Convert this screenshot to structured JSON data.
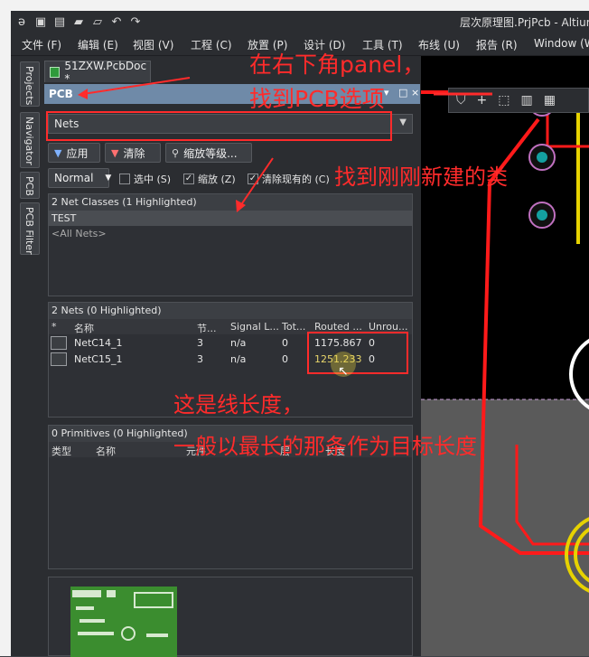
{
  "window": {
    "title": "层次原理图.PrjPcb - Altium"
  },
  "quick_access": [
    "folder-icon",
    "save-icon",
    "save-all-icon",
    "open-icon",
    "open-icon",
    "undo-icon",
    "redo-icon"
  ],
  "menu": [
    "文件 (F)",
    "编辑 (E)",
    "视图 (V)",
    "工程 (C)",
    "放置 (P)",
    "设计 (D)",
    "工具 (T)",
    "布线 (U)",
    "报告 (R)",
    "Window (W"
  ],
  "side_tabs": [
    "Projects",
    "Navigator",
    "PCB",
    "PCB Filter"
  ],
  "doc_tab": "51ZXW.PcbDoc *",
  "panel": {
    "title": "PCB",
    "header_buttons": [
      "▾",
      "□",
      "×"
    ],
    "mode_dropdown": "Nets",
    "buttons": {
      "apply": "应用",
      "clear": "清除",
      "zoom": "缩放等级..."
    },
    "view_mode": "Normal",
    "checkboxes": [
      {
        "label": "选中 (S)",
        "checked": false
      },
      {
        "label": "缩放 (Z)",
        "checked": true
      },
      {
        "label": "清除现有的 (C)",
        "checked": true
      }
    ],
    "net_classes": {
      "header": "2 Net Classes (1 Highlighted)",
      "items": [
        "TEST",
        "<All Nets>"
      ]
    },
    "nets": {
      "header": "2 Nets (0 Highlighted)",
      "columns": [
        "*",
        "名称",
        "节...",
        "Signal L...",
        "Tot...",
        "Routed ...",
        "Unrou..."
      ],
      "rows": [
        {
          "name": "NetC14_1",
          "nodes": "3",
          "signal": "n/a",
          "total": "0",
          "routed": "1175.867",
          "unrouted": "0"
        },
        {
          "name": "NetC15_1",
          "nodes": "3",
          "signal": "n/a",
          "total": "0",
          "routed": "1251.233",
          "unrouted": "0"
        }
      ]
    },
    "primitives": {
      "header": "0 Primitives (0 Highlighted)",
      "columns": [
        "类型",
        "名称",
        "元件",
        "层",
        "长度"
      ]
    }
  },
  "annotations": {
    "a1": "在右下角panel，",
    "a2": "找到PCB选项",
    "a3": "找到刚刚新建的类",
    "a4": "这是线长度，",
    "a5": "一般以最长的那条作为目标长度"
  },
  "colors": {
    "annotation": "#ff2b2b",
    "panel_header": "#6f8aa8",
    "board_track": "#ff1a1a",
    "keepout": "#e6d200"
  }
}
